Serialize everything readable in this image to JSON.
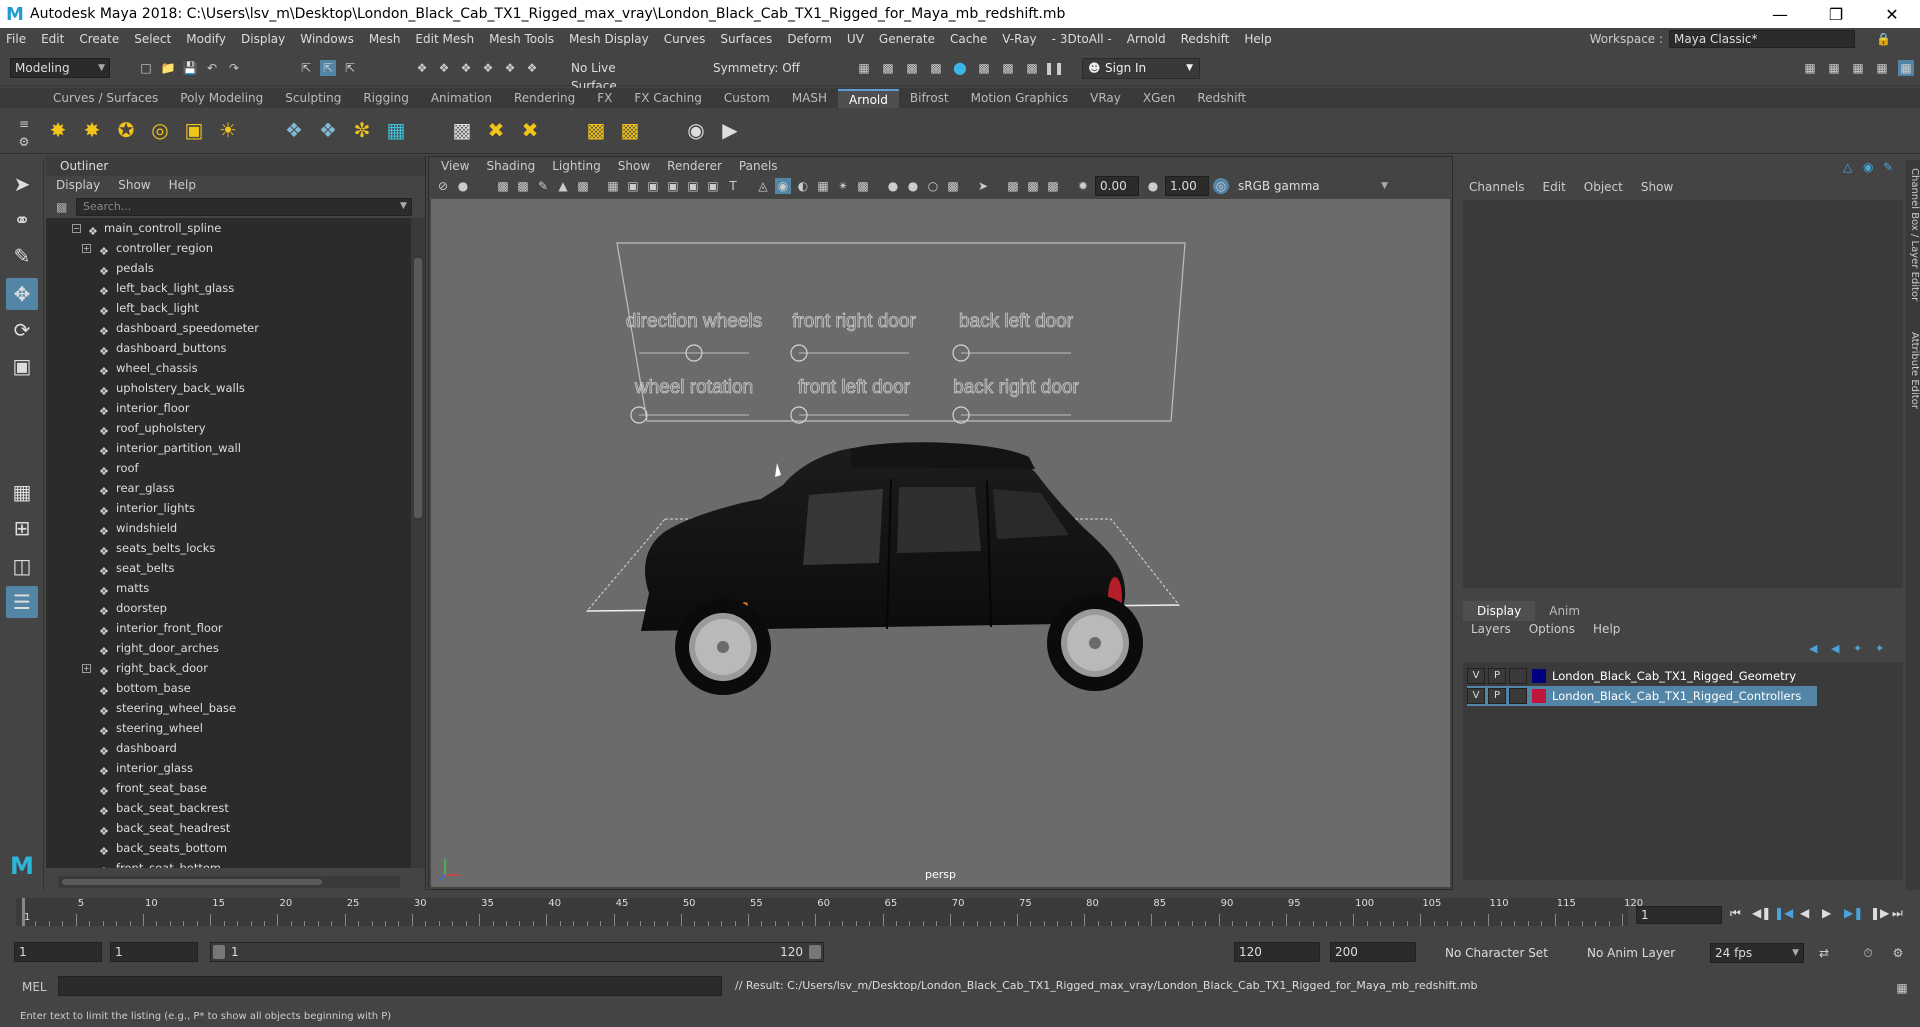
{
  "window": {
    "title": "Autodesk Maya 2018: C:\\Users\\lsv_m\\Desktop\\London_Black_Cab_TX1_Rigged_max_vray\\London_Black_Cab_TX1_Rigged_for_Maya_mb_redshift.mb",
    "logo": "M"
  },
  "menubar": [
    "File",
    "Edit",
    "Create",
    "Select",
    "Modify",
    "Display",
    "Windows",
    "Mesh",
    "Edit Mesh",
    "Mesh Tools",
    "Mesh Display",
    "Curves",
    "Surfaces",
    "Deform",
    "UV",
    "Generate",
    "Cache",
    "V-Ray",
    "- 3DtoAll -",
    "Arnold",
    "Redshift",
    "Help"
  ],
  "workspace": {
    "label": "Workspace :",
    "value": "Maya Classic*"
  },
  "statusline": {
    "mode": "Modeling",
    "live_surface": "No Live Surface",
    "symmetry": "Symmetry: Off",
    "sign_in": "Sign In"
  },
  "shelf_tabs": [
    "Curves / Surfaces",
    "Poly Modeling",
    "Sculpting",
    "Rigging",
    "Animation",
    "Rendering",
    "FX",
    "FX Caching",
    "Custom",
    "MASH",
    "Arnold",
    "Bifrost",
    "Motion Graphics",
    "VRay",
    "XGen",
    "Redshift"
  ],
  "shelf_active": "Arnold",
  "outliner": {
    "title": "Outliner",
    "menu": [
      "Display",
      "Show",
      "Help"
    ],
    "search_placeholder": "Search...",
    "root": "main_controll_spline",
    "items": [
      {
        "name": "controller_region",
        "expandable": true
      },
      {
        "name": "pedals",
        "expandable": false
      },
      {
        "name": "left_back_light_glass",
        "expandable": false
      },
      {
        "name": "left_back_light",
        "expandable": false
      },
      {
        "name": "dashboard_speedometer",
        "expandable": false
      },
      {
        "name": "dashboard_buttons",
        "expandable": false
      },
      {
        "name": "wheel_chassis",
        "expandable": false
      },
      {
        "name": "upholstery_back_walls",
        "expandable": false
      },
      {
        "name": "interior_floor",
        "expandable": false
      },
      {
        "name": "roof_upholstery",
        "expandable": false
      },
      {
        "name": "interior_partition_wall",
        "expandable": false
      },
      {
        "name": "roof",
        "expandable": false
      },
      {
        "name": "rear_glass",
        "expandable": false
      },
      {
        "name": "interior_lights",
        "expandable": false
      },
      {
        "name": "windshield",
        "expandable": false
      },
      {
        "name": "seats_belts_locks",
        "expandable": false
      },
      {
        "name": "seat_belts",
        "expandable": false
      },
      {
        "name": "matts",
        "expandable": false
      },
      {
        "name": "doorstep",
        "expandable": false
      },
      {
        "name": "interior_front_floor",
        "expandable": false
      },
      {
        "name": "right_door_arches",
        "expandable": false
      },
      {
        "name": "right_back_door",
        "expandable": true
      },
      {
        "name": "bottom_base",
        "expandable": false
      },
      {
        "name": "steering_wheel_base",
        "expandable": false
      },
      {
        "name": "steering_wheel",
        "expandable": false
      },
      {
        "name": "dashboard",
        "expandable": false
      },
      {
        "name": "interior_glass",
        "expandable": false
      },
      {
        "name": "front_seat_base",
        "expandable": false
      },
      {
        "name": "back_seat_backrest",
        "expandable": false
      },
      {
        "name": "back_seat_headrest",
        "expandable": false
      },
      {
        "name": "back_seats_bottom",
        "expandable": false
      },
      {
        "name": "front_seat_bottom",
        "expandable": false
      }
    ]
  },
  "viewport": {
    "menu": [
      "View",
      "Shading",
      "Lighting",
      "Show",
      "Renderer",
      "Panels"
    ],
    "field_a": "0.00",
    "field_b": "1.00",
    "colorspace": "sRGB gamma",
    "camera": "persp",
    "controls": [
      {
        "label": "direction wheels",
        "value": 0.5
      },
      {
        "label": "front right door",
        "value": 0.0
      },
      {
        "label": "back left door",
        "value": 0.0
      },
      {
        "label": "wheel rotation",
        "value": 0.0
      },
      {
        "label": "front left door",
        "value": 0.0
      },
      {
        "label": "back right door",
        "value": 0.0
      }
    ]
  },
  "channel_box": {
    "menu": [
      "Channels",
      "Edit",
      "Object",
      "Show"
    ],
    "side_tabs": [
      "Channel Box / Layer Editor",
      "Attribute Editor"
    ]
  },
  "layer_editor": {
    "tabs": [
      "Display",
      "Anim"
    ],
    "active_tab": "Display",
    "menu": [
      "Layers",
      "Options",
      "Help"
    ],
    "layers": [
      {
        "v": "V",
        "p": "P",
        "color": "#000080",
        "name": "London_Black_Cab_TX1_Rigged_Geometry",
        "selected": false
      },
      {
        "v": "V",
        "p": "P",
        "color": "#c0143c",
        "name": "London_Black_Cab_TX1_Rigged_Controllers",
        "selected": true
      }
    ]
  },
  "timeline": {
    "ticks": [
      1,
      5,
      10,
      15,
      20,
      25,
      30,
      35,
      40,
      45,
      50,
      55,
      60,
      65,
      70,
      75,
      80,
      85,
      90,
      95,
      100,
      105,
      110,
      115,
      120
    ],
    "current_frame": "1"
  },
  "range": {
    "start": "1",
    "inner_start": "1",
    "range_start_label": "1",
    "range_end_label": "120",
    "end": "120",
    "anim_end": "200",
    "character_set": "No Character Set",
    "anim_layer": "No Anim Layer",
    "fps": "24 fps"
  },
  "command_line": {
    "label": "MEL",
    "result": "// Result: C:/Users/lsv_m/Desktop/London_Black_Cab_TX1_Rigged_max_vray/London_Black_Cab_TX1_Rigged_for_Maya_mb_redshift.mb"
  },
  "help_line": "Enter text to limit the listing (e.g., P* to show all objects beginning with P)"
}
